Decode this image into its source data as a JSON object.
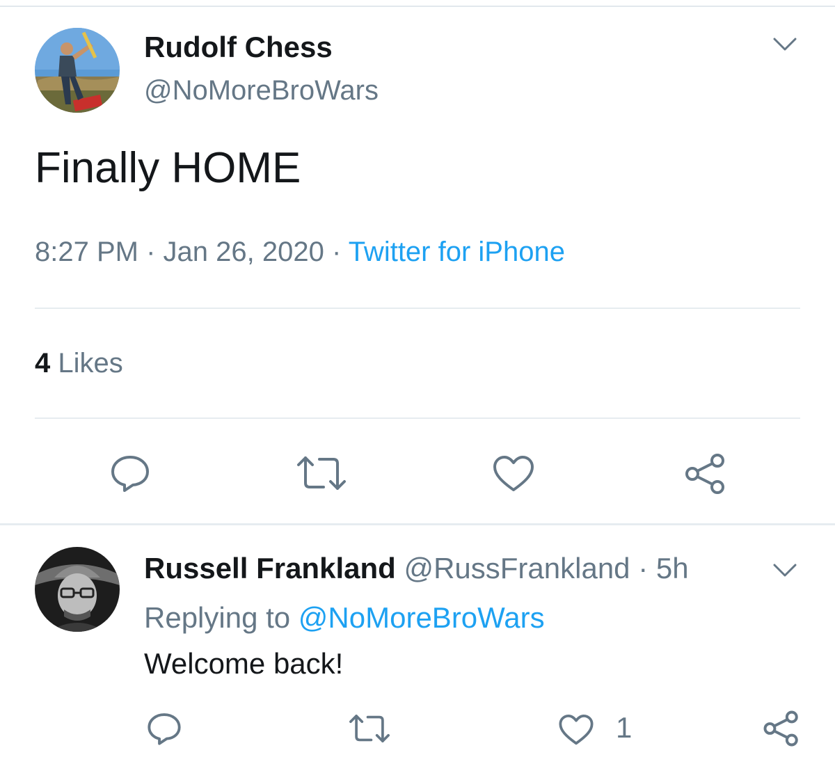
{
  "tweet": {
    "author_name": "Rudolf Chess",
    "author_handle": "@NoMoreBroWars",
    "text": "Finally HOME",
    "time": "8:27 PM",
    "separator": "·",
    "date": "Jan 26, 2020",
    "source": "Twitter for iPhone",
    "likes_count": "4",
    "likes_label": "Likes",
    "icons": {
      "more": "chevron-down-icon",
      "reply": "reply-icon",
      "retweet": "retweet-icon",
      "like": "heart-icon",
      "share": "share-icon"
    }
  },
  "reply": {
    "author_name": "Russell Frankland",
    "author_handle": "@RussFrankland",
    "separator": "·",
    "age": "5h",
    "replying_label": "Replying to",
    "replying_to": "@NoMoreBroWars",
    "text": "Welcome back!",
    "like_count": "1"
  },
  "colors": {
    "link": "#1da1f2",
    "secondary_text": "#657786",
    "primary_text": "#14171a",
    "divider": "#e6ecf0"
  }
}
